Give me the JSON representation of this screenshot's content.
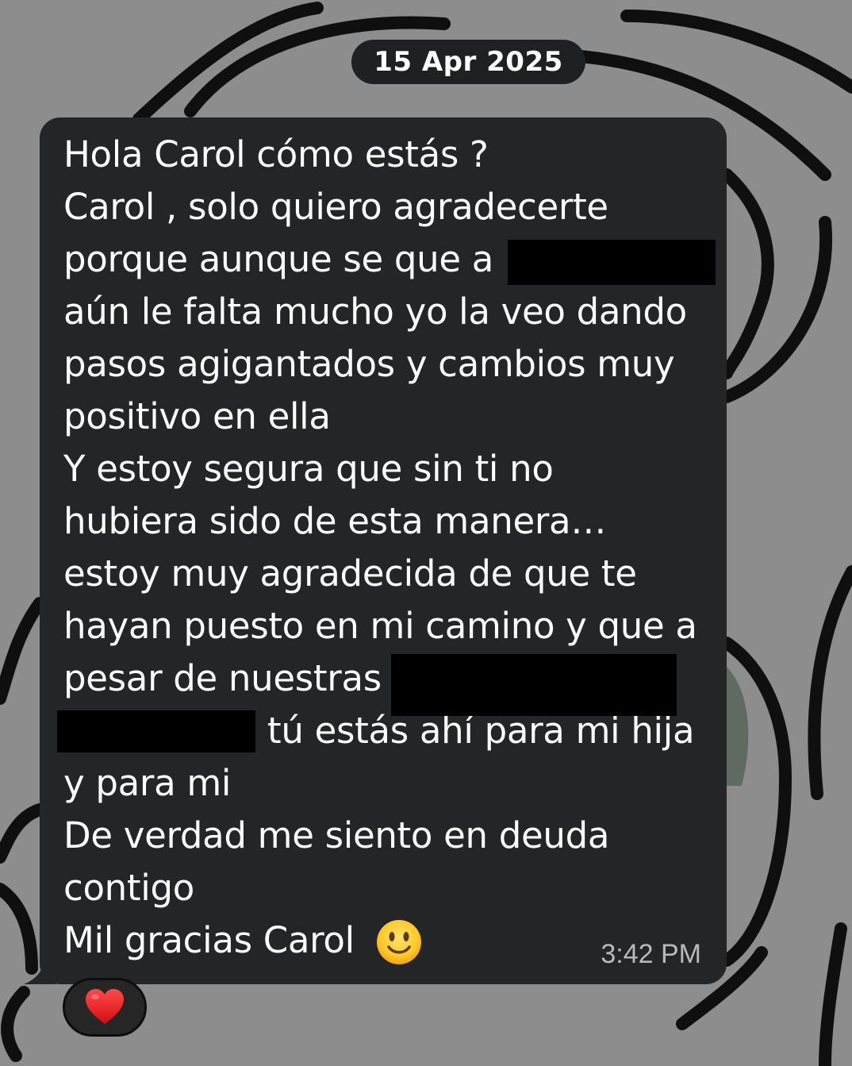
{
  "date_separator": "15 Apr 2025",
  "message": {
    "lines": [
      "Hola Carol cómo estás ?",
      "Carol , solo quiero agradecerte",
      "porque aunque se que a",
      "aún le falta mucho yo la veo dando",
      "pasos agigantados y cambios muy",
      "positivo en ella",
      "Y estoy segura que sin ti no",
      "hubiera sido de esta manera…",
      "estoy muy agradecida de que te",
      "hayan puesto en mi camino y que a",
      "pesar de nuestras",
      "tú estás ahí para mi hija",
      "y para mi",
      "De verdad me siento en deuda",
      "contigo",
      "Mil gracias Carol"
    ],
    "emoji": "slightly-smiling-face-icon",
    "time": "3:42 PM"
  },
  "reaction": {
    "emoji": "red-heart-icon"
  },
  "colors": {
    "background": "#8d8d8d",
    "bubble": "#242526",
    "date_pill": "#1f2021",
    "text": "#ffffff",
    "timestamp": "#b9b9b9",
    "redaction": "#000000"
  }
}
